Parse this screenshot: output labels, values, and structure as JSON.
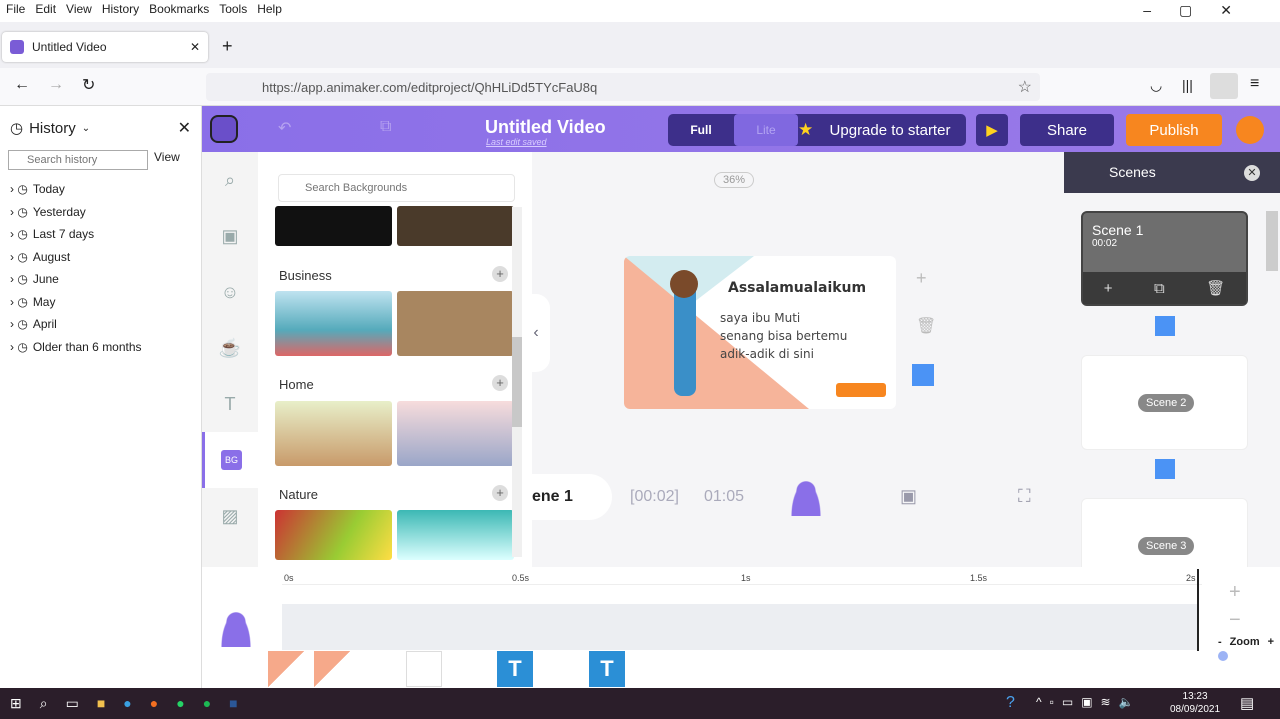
{
  "browser": {
    "menu": [
      "File",
      "Edit",
      "View",
      "History",
      "Bookmarks",
      "Tools",
      "Help"
    ],
    "tab_title": "Untitled Video",
    "url": "https://app.animaker.com/editproject/QhHLiDd5TYcFaU8q"
  },
  "history": {
    "title": "History",
    "search_placeholder": "Search history",
    "view_label": "View",
    "items": [
      "Today",
      "Yesterday",
      "Last 7 days",
      "August",
      "June",
      "May",
      "April",
      "Older than 6 months"
    ]
  },
  "app": {
    "title": "Untitled Video",
    "subtitle": "Last edit saved",
    "mode_full": "Full",
    "mode_lite": "Lite",
    "upgrade": "Upgrade to starter",
    "share": "Share",
    "publish": "Publish",
    "accent": "#8a6fe8",
    "publish_color": "#f7861f"
  },
  "backgrounds": {
    "search_placeholder": "Search Backgrounds",
    "categories": [
      "Business",
      "Home",
      "Nature"
    ],
    "tab_badge": "BG"
  },
  "canvas": {
    "zoom": "36%",
    "heading": "Assalamualaikum",
    "lines": [
      "saya ibu Muti",
      "senang bisa bertemu",
      "adik-adik di sini"
    ],
    "scene_label": "ene 1",
    "scene_time": "[00:02]",
    "total_time": "01:05"
  },
  "scenes": {
    "title": "Scenes",
    "items": [
      {
        "name": "Scene 1",
        "time": "00:02"
      },
      {
        "name": "Scene 2"
      },
      {
        "name": "Scene 3"
      }
    ]
  },
  "timeline": {
    "ticks": [
      "0s",
      "0.5s",
      "1s",
      "1.5s",
      "2s"
    ],
    "zoom_label": "Zoom",
    "zoom_minus": "-",
    "zoom_plus": "+",
    "text_tracks": [
      "T",
      "T"
    ]
  },
  "taskbar": {
    "time": "13:23",
    "date": "08/09/2021"
  }
}
